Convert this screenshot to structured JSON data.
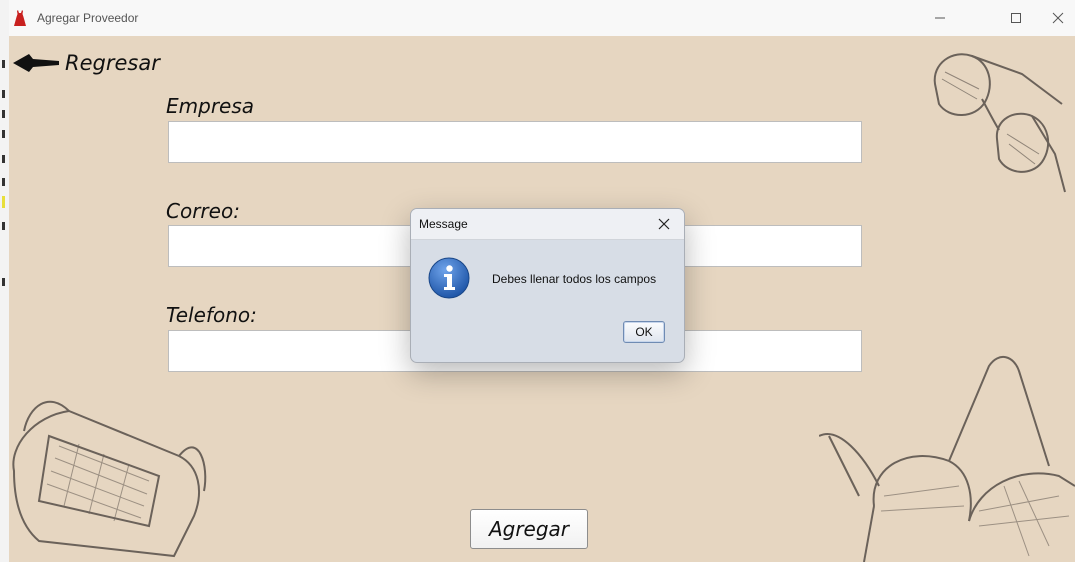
{
  "window": {
    "title": "Agregar Proveedor",
    "icon": "red-dress-icon",
    "controls": [
      "minimize-icon",
      "maximize-icon",
      "close-icon"
    ]
  },
  "back": {
    "label": "Regresar",
    "icon": "arrow-left-icon"
  },
  "form": {
    "empresa_label": "Empresa",
    "empresa_value": "",
    "correo_label": "Correo:",
    "correo_value": "",
    "telefono_label": "Telefono:",
    "telefono_value": "",
    "submit_label": "Agregar"
  },
  "dialog": {
    "title": "Message",
    "message": "Debes llenar todos los campos",
    "ok_label": "OK",
    "icon": "info-icon"
  },
  "decorations": [
    "sunglasses-illustration",
    "handbag-illustration",
    "bra-illustration"
  ],
  "colors": {
    "background": "#e6d6c1",
    "dialog_bg": "#d7dde6",
    "info_blue": "#2f6fc4",
    "sketch": "#6b625a"
  }
}
